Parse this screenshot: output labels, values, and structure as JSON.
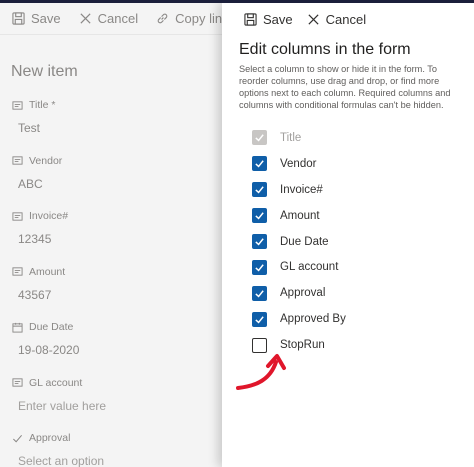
{
  "form": {
    "toolbar": {
      "save": "Save",
      "cancel": "Cancel",
      "copy_link": "Copy link"
    },
    "title": "New item",
    "fields": [
      {
        "icon": "text-field-icon",
        "label": "Title *",
        "value": "Test",
        "placeholder": false
      },
      {
        "icon": "text-field-icon",
        "label": "Vendor",
        "value": "ABC",
        "placeholder": false
      },
      {
        "icon": "text-field-icon",
        "label": "Invoice#",
        "value": "12345",
        "placeholder": false
      },
      {
        "icon": "text-field-icon",
        "label": "Amount",
        "value": "43567",
        "placeholder": false
      },
      {
        "icon": "calendar-icon",
        "label": "Due Date",
        "value": "19-08-2020",
        "placeholder": false
      },
      {
        "icon": "text-field-icon",
        "label": "GL account",
        "value": "Enter value here",
        "placeholder": true
      },
      {
        "icon": "check-icon",
        "label": "Approval",
        "value": "Select an option",
        "placeholder": true
      }
    ]
  },
  "panel": {
    "toolbar": {
      "save": "Save",
      "cancel": "Cancel"
    },
    "title": "Edit columns in the form",
    "description": "Select a column to show or hide it in the form. To reorder columns, use drag and drop, or find more options next to each column. Required columns and columns with conditional formulas can't be hidden.",
    "columns": [
      {
        "label": "Title",
        "checked": true,
        "disabled": true
      },
      {
        "label": "Vendor",
        "checked": true,
        "disabled": false
      },
      {
        "label": "Invoice#",
        "checked": true,
        "disabled": false
      },
      {
        "label": "Amount",
        "checked": true,
        "disabled": false
      },
      {
        "label": "Due Date",
        "checked": true,
        "disabled": false
      },
      {
        "label": "GL account",
        "checked": true,
        "disabled": false
      },
      {
        "label": "Approval",
        "checked": true,
        "disabled": false
      },
      {
        "label": "Approved By",
        "checked": true,
        "disabled": false
      },
      {
        "label": "StopRun",
        "checked": false,
        "disabled": false
      }
    ]
  },
  "colors": {
    "accent": "#0f5ea8",
    "annotation": "#e0162b",
    "top_bar": "#1b1f3b"
  }
}
